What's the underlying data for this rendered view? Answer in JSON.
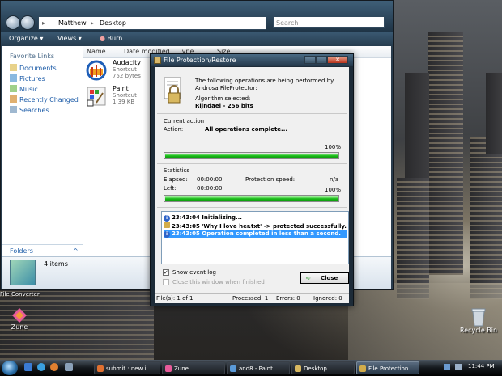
{
  "explorer": {
    "breadcrumb": [
      "Matthew",
      "Desktop"
    ],
    "search_placeholder": "Search",
    "toolbar": {
      "organize": "Organize",
      "views": "Views",
      "burn": "Burn"
    },
    "favorite_links_title": "Favorite Links",
    "favorite_links": [
      "Documents",
      "Pictures",
      "Music",
      "Recently Changed",
      "Searches"
    ],
    "folders_label": "Folders",
    "columns": [
      "Name",
      "Date modified",
      "Type",
      "Size"
    ],
    "files": [
      {
        "name": "Audacity",
        "type": "Shortcut",
        "size": "752 bytes"
      },
      {
        "name": "Paint",
        "type": "Shortcut",
        "size": "1.39 KB"
      }
    ],
    "details_count": "4 items"
  },
  "dialog": {
    "title": "File Protection/Restore",
    "intro": "The following operations are being performed by Androsa FileProtector:",
    "algorithm_label": "Algorithm selected:",
    "algorithm_value": "Rijndael - 256 bits",
    "current_action_header": "Current action",
    "action_label": "Action:",
    "action_value": "All operations complete...",
    "action_percent_text": "100%",
    "action_progress": 1.0,
    "statistics_header": "Statistics",
    "elapsed_label": "Elapsed:",
    "elapsed_value": "00:00:00",
    "speed_label": "Protection speed:",
    "speed_value": "n/a",
    "left_label": "Left:",
    "left_value": "00:00:00",
    "overall_percent_text": "100%",
    "overall_progress": 1.0,
    "log": [
      {
        "text": "23:43:04 Initializing...",
        "icon": "info-icon",
        "selected": false
      },
      {
        "text": "23:43:05 'Why I love her.txt' -> protected successfully.",
        "icon": "lock-icon",
        "selected": false
      },
      {
        "text": "23:43:05 Operation completed in less than a second.",
        "icon": "info-icon",
        "selected": true
      }
    ],
    "show_event_log_label": "Show event log",
    "show_event_log_checked": true,
    "close_when_finished_label": "Close this window when finished",
    "close_button": "Close",
    "status": {
      "files": "File(s): 1 of 1",
      "processed": "Processed: 1",
      "errors": "Errors: 0",
      "ignored": "Ignored: 0"
    }
  },
  "desktop": {
    "zune_icon_label": "Zune",
    "recycle_bin_label": "Recycle Bin",
    "file_converter_label": "File Converter"
  },
  "taskbar": {
    "buttons": [
      {
        "label": "submit : new i..."
      },
      {
        "label": "Zune"
      },
      {
        "label": "and8 - Paint"
      },
      {
        "label": "Desktop"
      },
      {
        "label": "File Protection..."
      }
    ],
    "clock": "11:44 PM"
  },
  "colors": {
    "progress_green": "#20c11e",
    "selection_blue": "#3399ff",
    "link_blue": "#1d5ca8"
  }
}
